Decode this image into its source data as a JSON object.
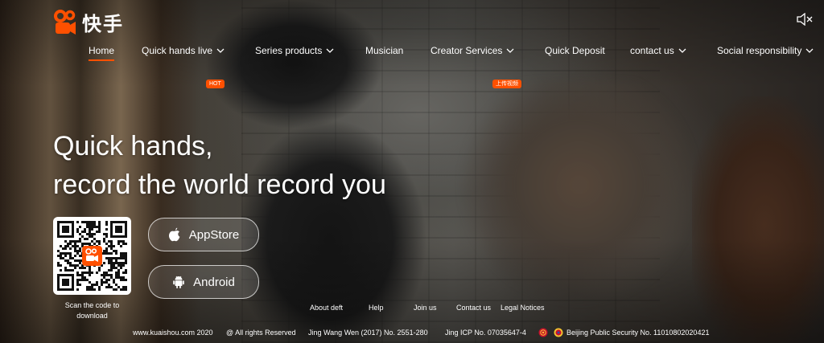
{
  "brand": {
    "name": "快手",
    "accent": "#ff5000"
  },
  "nav": {
    "items": [
      {
        "label": "Home",
        "active": true
      },
      {
        "label": "Quick hands live",
        "badge": "HOT",
        "dropdown": true
      },
      {
        "label": "Series products",
        "dropdown": true
      },
      {
        "label": "Musician"
      },
      {
        "label": "Creator Services",
        "badge": "上传视频",
        "dropdown": true
      },
      {
        "label": "Quick Deposit"
      },
      {
        "label": "contact us",
        "dropdown": true
      },
      {
        "label": "Social responsibility",
        "dropdown": true
      }
    ]
  },
  "hero": {
    "line1": "Quick hands,",
    "line2": "record the world record you"
  },
  "download": {
    "qr_caption": "Scan the code to download",
    "appstore_label": "AppStore",
    "android_label": "Android"
  },
  "footer": {
    "links": [
      "About deft",
      "Help",
      "Join us",
      "Contact us",
      "Legal Notices"
    ],
    "site": "www.kuaishou.com 2020",
    "rights": "@ All rights Reserved",
    "license": "Jing Wang Wen (2017) No. 2551-280",
    "icp": "Jing ICP No. 07035647-4",
    "security": "Beijing Public Security No. 11010802020421"
  },
  "icons": [
    "kuaishou-logo-icon",
    "mute-icon",
    "chevron-down-icon",
    "apple-icon",
    "android-icon",
    "qr-code-icon",
    "emblem-icon",
    "police-badge-icon"
  ]
}
